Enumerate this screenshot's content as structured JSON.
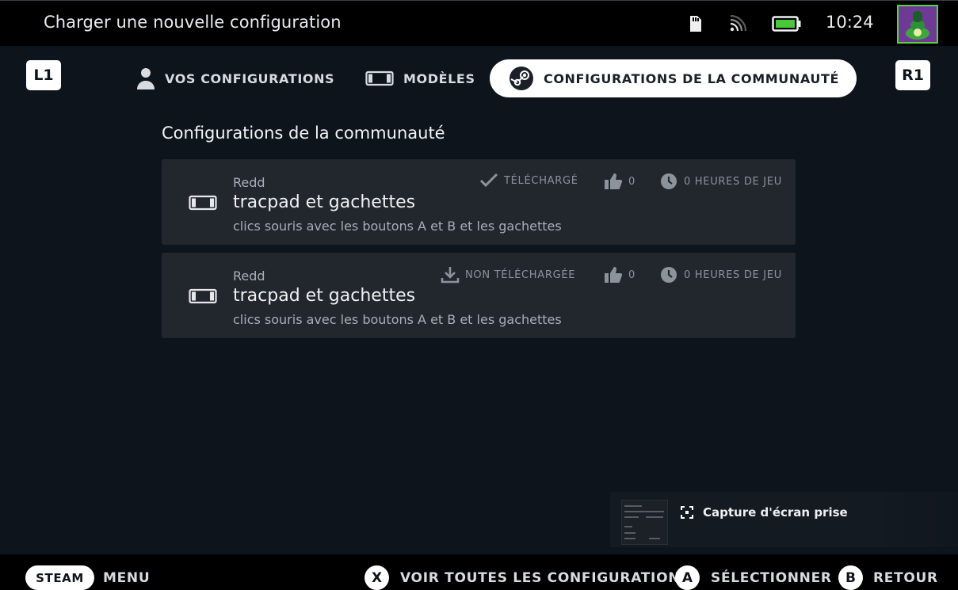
{
  "topbar": {
    "title": "Charger une nouvelle configuration",
    "clock": "10:24",
    "icons": [
      "sd-card-icon",
      "wifi-icon",
      "battery-icon"
    ],
    "battery_color": "#49c93a"
  },
  "tabs": {
    "left_bumper": "L1",
    "right_bumper": "R1",
    "items": [
      {
        "label": "VOS CONFIGURATIONS",
        "icon": "person-icon"
      },
      {
        "label": "MODÈLES",
        "icon": "controller-icon"
      },
      {
        "label": "CONFIGURATIONS DE LA COMMUNAUTÉ",
        "icon": "steam-logo-icon",
        "active": true
      }
    ]
  },
  "section": {
    "title": "Configurations de la communauté"
  },
  "configs": [
    {
      "author": "Redd",
      "name": "tracpad et gachettes",
      "description": "clics souris avec les boutons A et B et les gachettes",
      "download_status": "TÉLÉCHARGÉ",
      "status_icon": "checkmark-icon",
      "likes": "0",
      "playtime": "0 HEURES DE JEU"
    },
    {
      "author": "Redd",
      "name": "tracpad et gachettes",
      "description": "clics souris avec les boutons A et B et les gachettes",
      "download_status": "NON TÉLÉCHARGÉE",
      "status_icon": "download-icon",
      "likes": "0",
      "playtime": "0 HEURES DE JEU"
    }
  ],
  "toast": {
    "text": "Capture d'écran prise"
  },
  "bottombar": {
    "steam_label": "STEAM",
    "menu_label": "MENU",
    "x_button": "X",
    "x_label": "VOIR TOUTES LES CONFIGURATIONS",
    "a_button": "A",
    "a_label": "SÉLECTIONNER",
    "b_button": "B",
    "b_label": "RETOUR"
  }
}
